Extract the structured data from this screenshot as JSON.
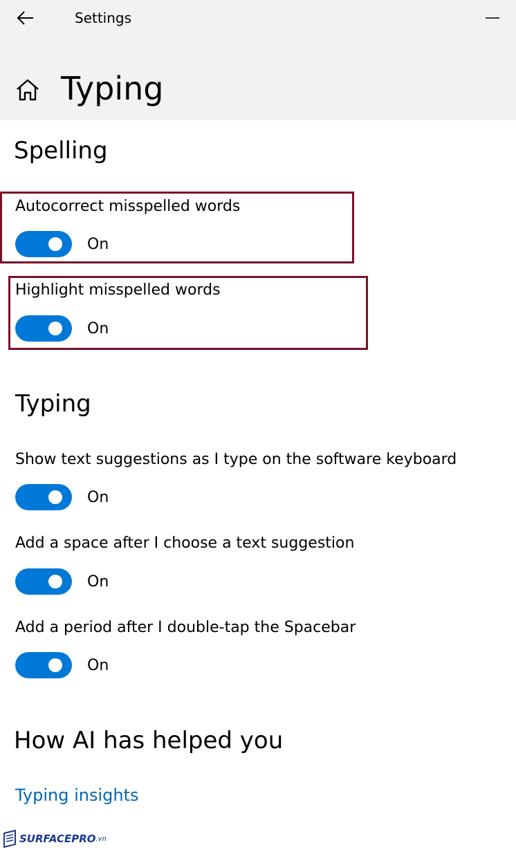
{
  "window": {
    "title": "Settings"
  },
  "header": {
    "page_title": "Typing"
  },
  "sections": {
    "spelling": {
      "title": "Spelling",
      "settings": [
        {
          "label": "Autocorrect misspelled words",
          "state": "On"
        },
        {
          "label": "Highlight misspelled words",
          "state": "On"
        }
      ]
    },
    "typing": {
      "title": "Typing",
      "settings": [
        {
          "label": "Show text suggestions as I type on the software keyboard",
          "state": "On"
        },
        {
          "label": "Add a space after I choose a text suggestion",
          "state": "On"
        },
        {
          "label": "Add a period after I double-tap the Spacebar",
          "state": "On"
        }
      ]
    },
    "ai": {
      "title": "How AI has helped you",
      "link": "Typing insights"
    }
  },
  "watermark": {
    "brand": "SURFACEPRO",
    "suffix": ".vn"
  },
  "icons": {
    "back": "back-arrow-icon",
    "minimize": "minimize-icon",
    "home": "home-icon",
    "watermark_logo": "surfacepro-logo-icon"
  },
  "colors": {
    "accent": "#0078d7",
    "link": "#0067b8",
    "highlight_box": "#7a1024",
    "header_background": "#f2f2f2"
  }
}
